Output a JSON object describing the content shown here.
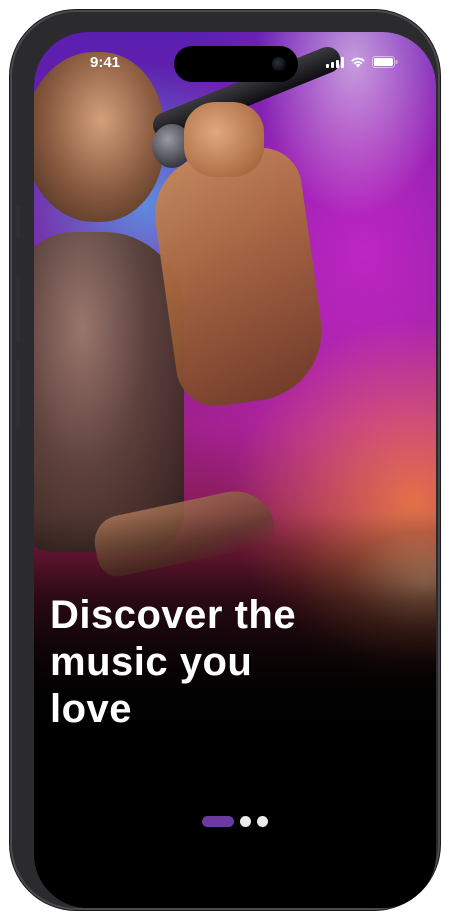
{
  "status_bar": {
    "time": "9:41",
    "icons": [
      "signal-icon",
      "wifi-icon",
      "battery-icon"
    ]
  },
  "onboarding": {
    "headline_lines": [
      "Discover the",
      "music you",
      "love"
    ],
    "background_image": "singer-with-microphone-photo",
    "page_indicator": {
      "total": 3,
      "current": 1,
      "active_color": "#6b3aa0",
      "inactive_color": "#ececec"
    }
  },
  "colors": {
    "text": "#ffffff",
    "background": "#000000",
    "frame": "#2b2b2d"
  }
}
